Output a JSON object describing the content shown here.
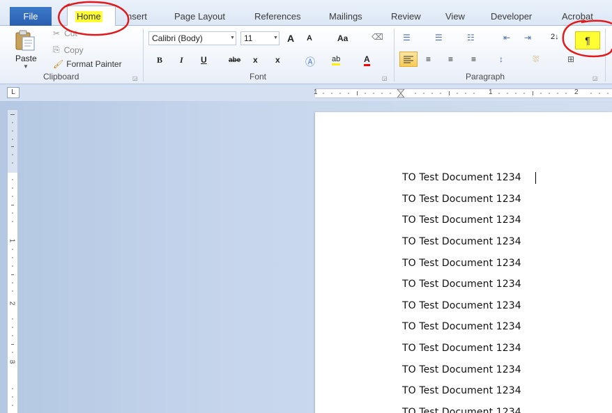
{
  "tabs": [
    {
      "label": "File"
    },
    {
      "label": "Home"
    },
    {
      "label": "nsert"
    },
    {
      "label": "Page Layout"
    },
    {
      "label": "References"
    },
    {
      "label": "Mailings"
    },
    {
      "label": "Review"
    },
    {
      "label": "View"
    },
    {
      "label": "Developer"
    },
    {
      "label": "Acrobat"
    }
  ],
  "clipboard": {
    "paste_label": "Paste",
    "cut_label": "Cut",
    "copy_label": "Copy",
    "format_painter_label": "Format Painter",
    "caption": "Clipboard"
  },
  "font": {
    "family": "Calibri (Body)",
    "size": "11",
    "grow": "A",
    "shrink": "A",
    "change_case": "Aa",
    "bold": "B",
    "italic": "I",
    "underline": "U",
    "strike": "abe",
    "subscript": "x",
    "superscript": "x",
    "font_color": "A",
    "caption": "Font"
  },
  "paragraph": {
    "pilcrow": "¶",
    "sort": "2↓",
    "caption": "Paragraph"
  },
  "ruler": {
    "tab_selector": "L",
    "marks": [
      "1",
      "1",
      "2"
    ],
    "vmarks": [
      "1",
      "2",
      "3"
    ]
  },
  "document": {
    "lines": [
      "TO Test Document 1234",
      "TO Test Document 1234",
      "TO Test Document 1234",
      "TO Test Document 1234",
      "TO Test Document 1234",
      "TO Test Document 1234",
      "TO Test Document 1234",
      "TO Test Document 1234",
      "TO Test Document 1234",
      "TO Test Document 1234",
      "TO Test Document 1234",
      "TO Test Document 1234"
    ]
  },
  "colors": {
    "highlight": "#ffff33",
    "annotation": "#e0191b",
    "file_tab": "#2b5fb0"
  }
}
